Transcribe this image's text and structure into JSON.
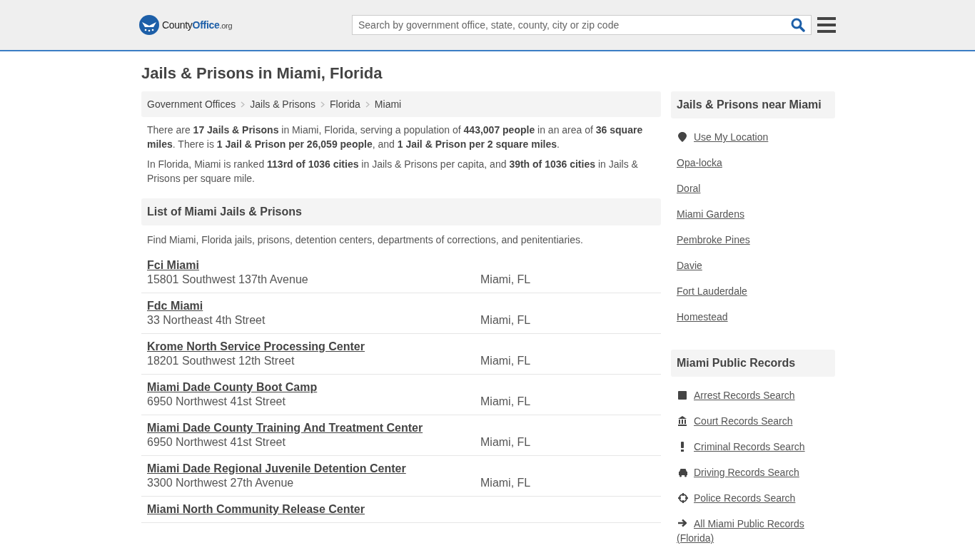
{
  "header": {
    "logo": {
      "name": "County",
      "accent": "Office",
      "suffix": ".org"
    },
    "search": {
      "placeholder": "Search by government office, state, county, city or zip code"
    }
  },
  "title": "Jails & Prisons in Miami, Florida",
  "breadcrumbs": [
    "Government Offices",
    "Jails & Prisons",
    "Florida",
    "Miami"
  ],
  "intro": [
    "There are **17 Jails & Prisons** in Miami, Florida, serving a population of **443,007 people** in an area of **36 square miles**. There is **1 Jail & Prison per 26,059 people**, and **1 Jail & Prison per 2 square miles**.",
    "In Florida, Miami is ranked **113rd of 1036 cities** in Jails & Prisons per capita, and **39th of 1036 cities** in Jails & Prisons per square mile."
  ],
  "list": {
    "heading": "List of Miami Jails & Prisons",
    "description": "Find Miami, Florida jails, prisons, detention centers, departments of corrections, and penitentiaries.",
    "items": [
      {
        "name": "Fci Miami",
        "address": "15801 Southwest 137th Avenue",
        "city": "Miami, FL"
      },
      {
        "name": "Fdc Miami",
        "address": "33 Northeast 4th Street",
        "city": "Miami, FL"
      },
      {
        "name": "Krome North Service Processing Center",
        "address": "18201 Southwest 12th Street",
        "city": "Miami, FL"
      },
      {
        "name": "Miami Dade County Boot Camp",
        "address": "6950 Northwest 41st Street",
        "city": "Miami, FL"
      },
      {
        "name": "Miami Dade County Training And Treatment Center",
        "address": "6950 Northwest 41st Street",
        "city": "Miami, FL"
      },
      {
        "name": "Miami Dade Regional Juvenile Detention Center",
        "address": "3300 Northwest 27th Avenue",
        "city": "Miami, FL"
      },
      {
        "name": "Miami North Community Release Center"
      }
    ]
  },
  "sidebar": [
    {
      "heading": "Jails & Prisons near Miami",
      "links": [
        {
          "label": "Use My Location",
          "kind": "pin"
        },
        {
          "label": "Opa-locka",
          "kind": "plain"
        },
        {
          "label": "Doral",
          "kind": "plain"
        },
        {
          "label": "Miami Gardens",
          "kind": "plain"
        },
        {
          "label": "Pembroke Pines",
          "kind": "plain"
        },
        {
          "label": "Davie",
          "kind": "plain"
        },
        {
          "label": "Fort Lauderdale",
          "kind": "plain"
        },
        {
          "label": "Homestead",
          "kind": "plain"
        }
      ]
    },
    {
      "heading": "Miami Public Records",
      "links": [
        {
          "label": "Arrest Records Search",
          "kind": "square"
        },
        {
          "label": "Court Records Search",
          "kind": "bank"
        },
        {
          "label": "Criminal Records Search",
          "kind": "exclamation"
        },
        {
          "label": "Driving Records Search",
          "kind": "car"
        },
        {
          "label": "Police Records Search",
          "kind": "crosshair"
        },
        {
          "label": "All Miami Public Records (Florida)",
          "kind": "arrow"
        }
      ]
    }
  ]
}
